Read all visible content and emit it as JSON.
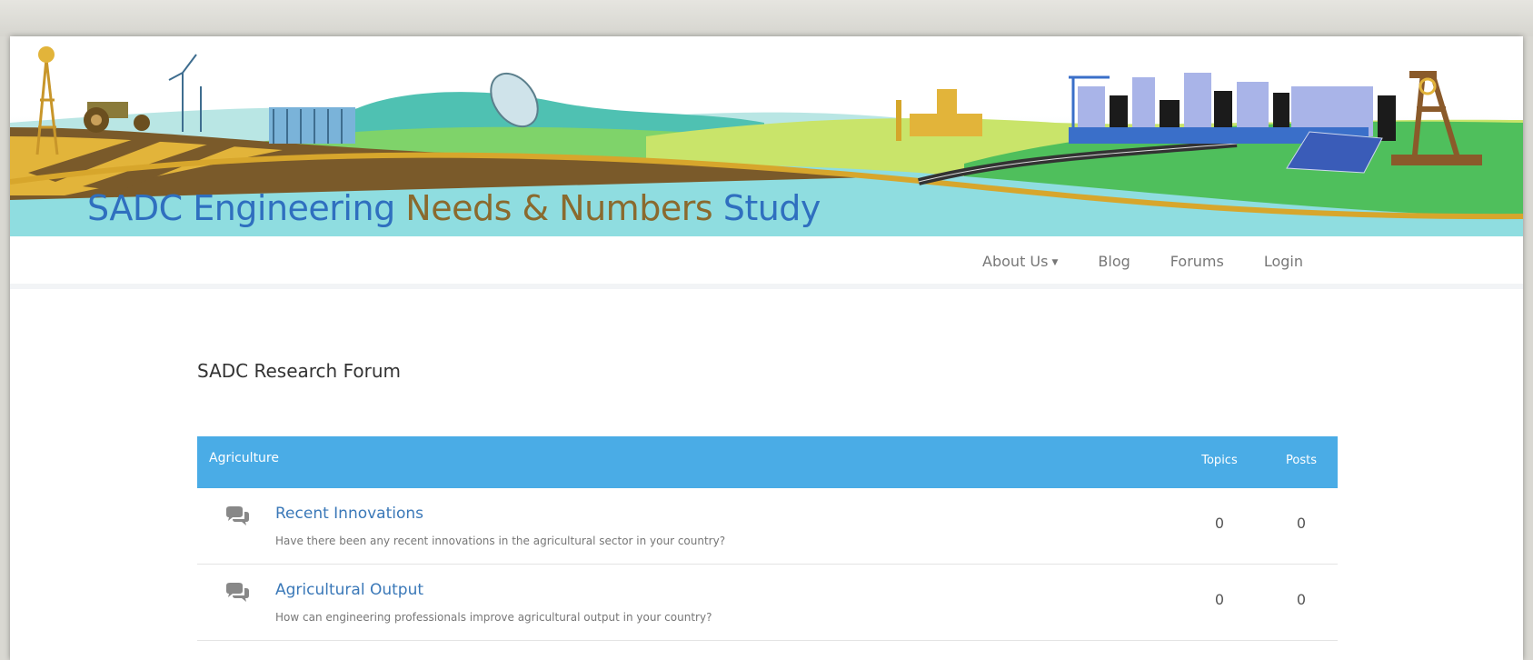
{
  "banner": {
    "title_part1": "SADC Engineering ",
    "title_part2": "Needs & Numbers",
    "title_part3": " Study"
  },
  "nav": {
    "items": [
      {
        "label": "About Us",
        "dropdown": true
      },
      {
        "label": "Blog"
      },
      {
        "label": "Forums"
      },
      {
        "label": "Login"
      }
    ]
  },
  "forum": {
    "title": "SADC Research Forum",
    "category": {
      "name": "Agriculture",
      "col_topics": "Topics",
      "col_posts": "Posts"
    },
    "rows": [
      {
        "title": "Recent Innovations",
        "description": "Have there been any recent innovations in the agricultural sector in your country?",
        "topics": "0",
        "posts": "0",
        "icon": "comments-icon"
      },
      {
        "title": "Agricultural Output",
        "description": "How can engineering professionals improve agricultural output in your country?",
        "topics": "0",
        "posts": "0",
        "icon": "comments-icon"
      }
    ]
  },
  "colors": {
    "header_blue": "#4aace6",
    "link_blue": "#3a78b8",
    "title_blue": "#2f6fbf",
    "title_brown": "#8a6a2e"
  }
}
